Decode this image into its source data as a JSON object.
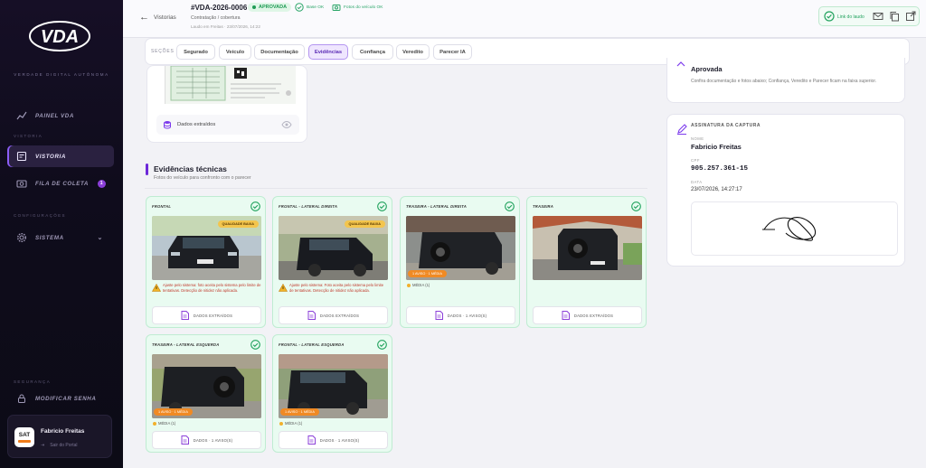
{
  "sidebar": {
    "brand": "VDA",
    "tagline": "VERDADE DIGITAL AUTÔNOMA",
    "nav": [
      {
        "label": "PAINEL VDA"
      },
      {
        "label": "VISTORIA"
      },
      {
        "label": "FILA DE COLETA",
        "badge": "1"
      },
      {
        "label": "SISTEMA"
      },
      {
        "label": "MODIFICAR SENHA"
      }
    ],
    "sections": [
      "VISTORIA",
      "CONFIGURAÇÕES",
      "SEGURANÇA"
    ],
    "user": {
      "avatar_text": "SAT",
      "name": "Fabricio Freitas",
      "logout": "Sair do Portal"
    }
  },
  "header": {
    "back_label": "Vistorias",
    "id": "#VDA-2026-0006",
    "status": "APROVADA",
    "check1": "Base OK",
    "check2": "Fotos do veículo OK",
    "subtitle": "Contratação / cobertura",
    "created": "Laudo em Freitas · 23/07/2026, 14:22",
    "link_label": "Link do laudo"
  },
  "tabs": {
    "label": "SEÇÕES",
    "items": [
      "Segurado",
      "Veículo",
      "Documentação",
      "Evidências",
      "Confiança",
      "Veredito",
      "Parecer IA"
    ],
    "active": "Evidências"
  },
  "document": {
    "extracted_label": "Dados extraídos"
  },
  "evidence": {
    "title": "Evidências técnicas",
    "subtitle": "Fotos do veículo para confronto com o parecer",
    "quality_badge": "QUALIDADE BAIXA",
    "medium_badge": "1 AVISO · 1 MÉDIA",
    "medium_text": "MÉDIA (1)",
    "cards": [
      {
        "label": "FRONTAL",
        "warning": "Ajuste pelo sistema: foto aceita pelo sistema pelo limite de tentativas. Detecção de nitidez não aplicada.",
        "button": "DADOS EXTRAÍDOS"
      },
      {
        "label": "FRONTAL - LATERAL DIREITA",
        "warning": "Ajuste pelo sistema: Foto aceita pelo sistema pelo limite de tentativas. Detecção de nitidez não aplicada.",
        "button": "DADOS EXTRAÍDOS"
      },
      {
        "label": "TRASEIRA - LATERAL DIREITA",
        "button": "DADOS · 1 AVISO(S)"
      },
      {
        "label": "TRASEIRA",
        "button": "DADOS EXTRAÍDOS"
      },
      {
        "label": "TRASEIRA - LATERAL ESQUERDA",
        "button": "DADOS · 1 AVISO(S)"
      },
      {
        "label": "FRONTAL - LATERAL ESQUERDA",
        "button": "DADOS · 1 AVISO(S)"
      }
    ]
  },
  "verdict": {
    "title": "Aprovada",
    "text": "Confira documentação e fotos abaixo; Confiança, Veredito e Parecer ficam na faixa superior."
  },
  "signature": {
    "header": "ASSINATURA DA CAPTURA",
    "name_label": "NOME",
    "name": "Fabricio Freitas",
    "cpf_label": "CPF",
    "cpf": "905.257.361-15",
    "date_label": "DATA",
    "date": "23/07/2026, 14:27:17"
  },
  "colors": {
    "accent": "#6d28d9",
    "success": "#22a35e",
    "sidebar_bg": "#0f0c1c"
  }
}
